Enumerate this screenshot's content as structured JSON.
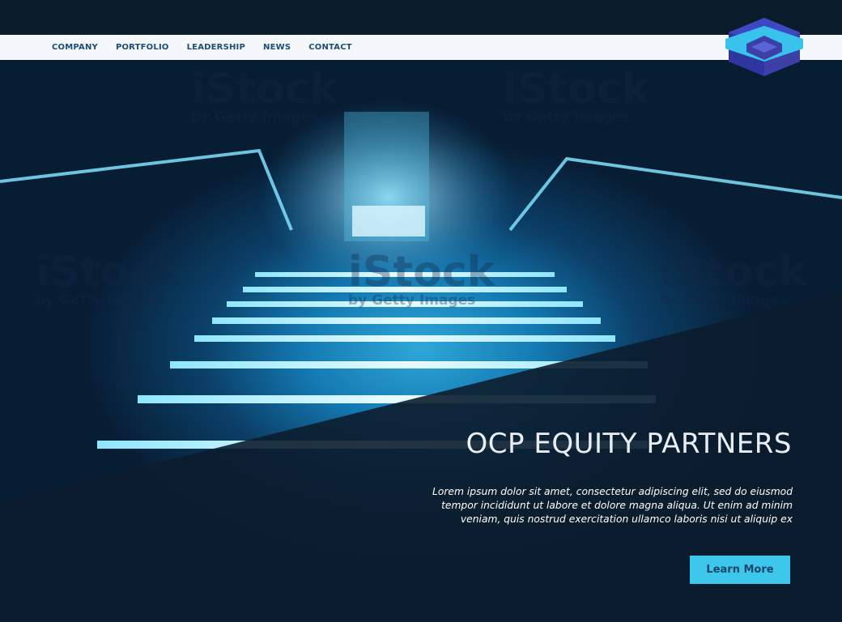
{
  "nav": {
    "items": [
      "COMPANY",
      "PORTFOLIO",
      "LEADERSHIP",
      "NEWS",
      "CONTACT"
    ]
  },
  "hero": {
    "title": "OCP EQUITY PARTNERS",
    "description": "Lorem ipsum dolor sit amet, consectetur adipiscing elit, sed do eiusmod tempor incididunt ut labore et dolore magna aliqua. Ut enim ad minim veniam, quis nostrud exercitation ullamco laboris nisi ut aliquip ex",
    "cta_label": "Learn More"
  },
  "watermark": {
    "brand": "iStock",
    "sub": "by Getty Images"
  },
  "colors": {
    "accent": "#3dc7ec",
    "nav_text": "#1d4c75",
    "dark": "#0a1b2b"
  },
  "logo": {
    "icon": "cube-logo-icon"
  }
}
